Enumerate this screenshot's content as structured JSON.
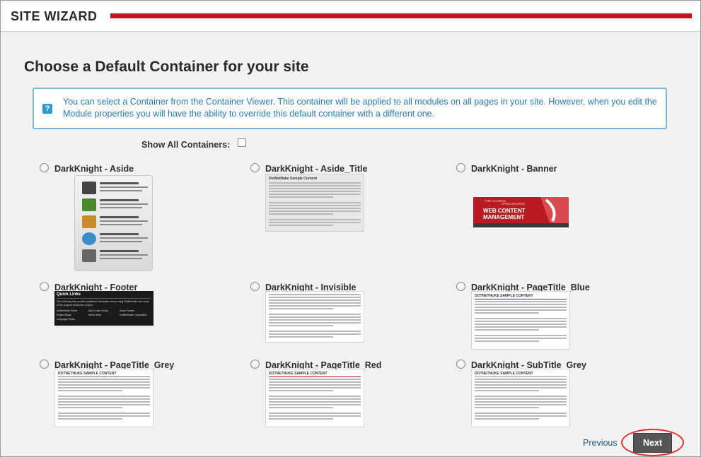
{
  "header": {
    "title": "SITE WIZARD"
  },
  "page_title": "Choose a Default Container for your site",
  "info": {
    "icon": "help-icon",
    "text": "You can select a Container from the Container Viewer. This container will be applied to all modules on all pages in your site. However, when you edit the Module properties you will have the ability to override this default container with a different one."
  },
  "show_all": {
    "label": "Show All Containers:",
    "checked": false
  },
  "containers": [
    {
      "label": "DarkKnight - Aside"
    },
    {
      "label": "DarkKnight - Aside_Title"
    },
    {
      "label": "DarkKnight - Banner"
    },
    {
      "label": "DarkKnight - Footer"
    },
    {
      "label": "DarkKnight - Invisible"
    },
    {
      "label": "DarkKnight - PageTitle_Blue"
    },
    {
      "label": "DarkKnight - PageTitle_Grey"
    },
    {
      "label": "DarkKnight - PageTitle_Red"
    },
    {
      "label": "DarkKnight - SubTitle_Grey"
    }
  ],
  "thumbs": {
    "aside_rows": [
      {
        "title": "COMMUNITY"
      },
      {
        "title": "SITE LEGEND"
      },
      {
        "title": "TRAINING"
      },
      {
        "title": "CONFERENCES"
      },
      {
        "title": "MARKETPLACE"
      }
    ],
    "aside_title_head": "DotNetNuke Sample Content",
    "footer_head": "Quick Links",
    "footer_intro": "The following links provide additional information about using DotNetNuke and some of the projects behind the project",
    "footer_links": [
      "DotNetNuke Home",
      "Join a User Group",
      "Issue Tracker",
      "Project Blogs",
      "Online Help",
      "DotNetNuke Corporation",
      "Language Packs",
      "",
      ""
    ],
    "banner_line1": "THE LEADING",
    "banner_line2": "OPEN SOURCE",
    "banner_line3": "WEB CONTENT",
    "banner_line4": "MANAGEMENT",
    "sample_head": "DOTNETNUKE SAMPLE CONTENT"
  },
  "nav": {
    "previous": "Previous",
    "next": "Next"
  },
  "colors": {
    "brand_red": "#c0171f",
    "info_border": "#79b6d9",
    "info_text": "#2a7ab8",
    "blue_rule": "#2b3a8c",
    "red_rule": "#c0171f",
    "grey_rule": "#7a7a7a"
  }
}
